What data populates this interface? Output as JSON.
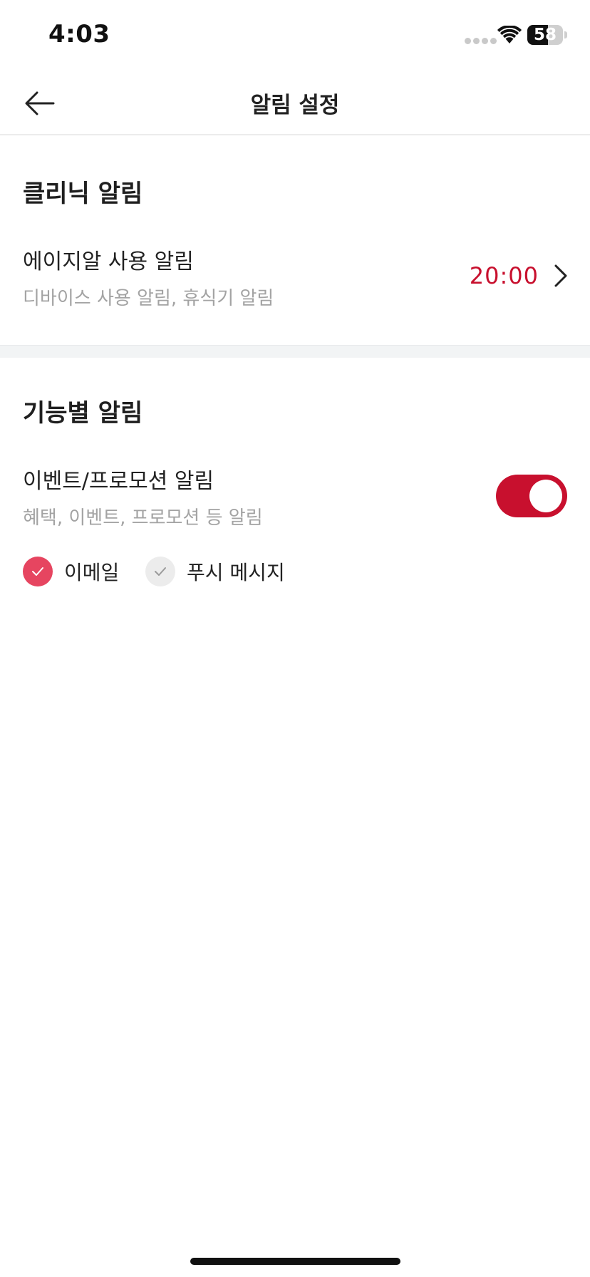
{
  "status_bar": {
    "time": "4:03",
    "battery_percent": "58",
    "battery_level": 0.58
  },
  "header": {
    "title": "알림 설정",
    "back_icon": "arrow-left-icon"
  },
  "clinic_section": {
    "title": "클리닉 알림",
    "items": [
      {
        "title": "에이지알 사용 알림",
        "subtitle": "디바이스 사용 알림, 휴식기 알림",
        "value": "20:00",
        "icon": "chevron-right-icon"
      }
    ]
  },
  "feature_section": {
    "title": "기능별 알림",
    "items": [
      {
        "title": "이벤트/프로모션 알림",
        "subtitle": "혜택, 이벤트, 프로모션 등 알림",
        "toggle_on": true,
        "options": [
          {
            "label": "이메일",
            "checked": true
          },
          {
            "label": "푸시 메시지",
            "checked": false
          }
        ]
      }
    ]
  },
  "colors": {
    "accent": "#c8102e",
    "checkbox_on": "#e64560",
    "checkbox_off": "#ececec",
    "subtitle_text": "#a3a3a3",
    "section_band": "#f2f4f5"
  }
}
